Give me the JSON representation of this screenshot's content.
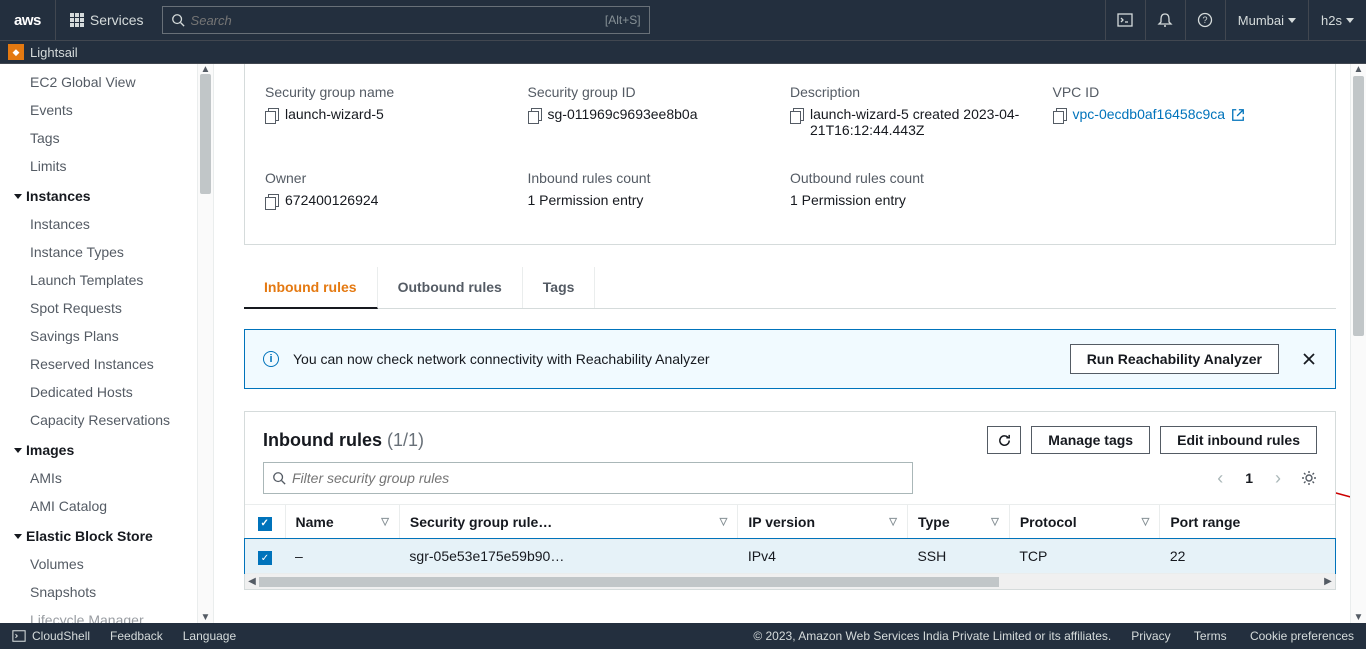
{
  "topbar": {
    "logo": "aws",
    "services": "Services",
    "search_placeholder": "Search",
    "search_hint": "[Alt+S]",
    "region": "Mumbai",
    "account": "h2s"
  },
  "secondbar": {
    "product": "Lightsail"
  },
  "sidebar": {
    "flat1": [
      "EC2 Global View",
      "Events",
      "Tags",
      "Limits"
    ],
    "groups": [
      {
        "title": "Instances",
        "items": [
          "Instances",
          "Instance Types",
          "Launch Templates",
          "Spot Requests",
          "Savings Plans",
          "Reserved Instances",
          "Dedicated Hosts",
          "Capacity Reservations"
        ]
      },
      {
        "title": "Images",
        "items": [
          "AMIs",
          "AMI Catalog"
        ]
      },
      {
        "title": "Elastic Block Store",
        "items": [
          "Volumes",
          "Snapshots",
          "Lifecycle Manager"
        ]
      }
    ]
  },
  "details": {
    "sg_name_label": "Security group name",
    "sg_name": "launch-wizard-5",
    "sg_id_label": "Security group ID",
    "sg_id": "sg-011969c9693ee8b0a",
    "desc_label": "Description",
    "desc": "launch-wizard-5 created 2023-04-21T16:12:44.443Z",
    "vpc_label": "VPC ID",
    "vpc": "vpc-0ecdb0af16458c9ca",
    "owner_label": "Owner",
    "owner": "672400126924",
    "in_count_label": "Inbound rules count",
    "in_count": "1 Permission entry",
    "out_count_label": "Outbound rules count",
    "out_count": "1 Permission entry"
  },
  "tabs": {
    "inbound": "Inbound rules",
    "outbound": "Outbound rules",
    "tags": "Tags"
  },
  "banner": {
    "msg": "You can now check network connectivity with Reachability Analyzer",
    "btn": "Run Reachability Analyzer"
  },
  "rules": {
    "title": "Inbound rules",
    "count": "(1/1)",
    "refresh": "Refresh",
    "manage_tags": "Manage tags",
    "edit": "Edit inbound rules",
    "filter_placeholder": "Filter security group rules",
    "page": "1",
    "cols": [
      "Name",
      "Security group rule…",
      "IP version",
      "Type",
      "Protocol",
      "Port range"
    ],
    "row": {
      "name": "–",
      "rule_id": "sgr-05e53e175e59b90…",
      "ip_version": "IPv4",
      "type": "SSH",
      "protocol": "TCP",
      "port": "22"
    }
  },
  "footer": {
    "cloudshell": "CloudShell",
    "feedback": "Feedback",
    "language": "Language",
    "copyright": "© 2023, Amazon Web Services India Private Limited or its affiliates.",
    "privacy": "Privacy",
    "terms": "Terms",
    "cookie": "Cookie preferences"
  }
}
